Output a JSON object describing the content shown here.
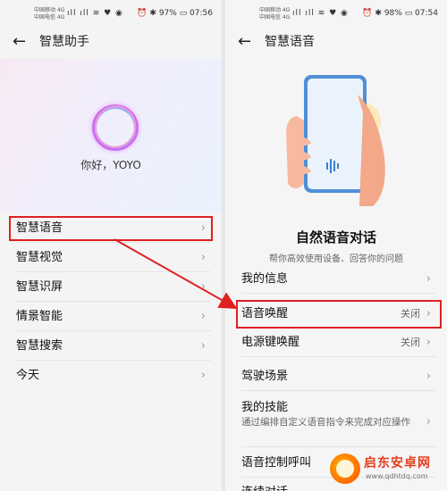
{
  "left": {
    "status": {
      "carrier1": "中国移动 4G",
      "carrier2": "中国电信 4G",
      "signal": "ıll ıll ≋ ♥ ◉",
      "right": "⏰ ✱ 97% ▭ 07:56"
    },
    "title": "智慧助手",
    "greeting": "你好，YOYO",
    "items": [
      {
        "label": "智慧语音"
      },
      {
        "label": "智慧视觉"
      },
      {
        "label": "智慧识屏"
      },
      {
        "label": "情景智能"
      },
      {
        "label": "智慧搜索"
      },
      {
        "label": "今天"
      }
    ]
  },
  "right": {
    "status": {
      "carrier1": "中国移动 4G",
      "carrier2": "中国电信 4G",
      "signal": "ıll ıll ≋ ♥ ◉",
      "right": "⏰ ✱ 98% ▭ 07:54"
    },
    "title": "智慧语音",
    "hero_title": "自然语音对话",
    "hero_subtitle": "帮你高效使用设备、回答你的问题",
    "items": [
      {
        "label": "我的信息",
        "value": ""
      },
      {
        "label": "语音唤醒",
        "value": "关闭"
      },
      {
        "label": "电源键唤醒",
        "value": "关闭"
      },
      {
        "label": "驾驶场景",
        "value": ""
      }
    ],
    "skill": {
      "label": "我的技能",
      "desc": "通过编排自定义语音指令来完成对应操作"
    },
    "bottom_items": [
      {
        "label": "语音控制呼叫"
      },
      {
        "label": "连续对话"
      }
    ]
  },
  "watermark": {
    "title": "启东安卓网",
    "url": "www.qdhtdq.com"
  },
  "colors": {
    "highlight": "#e02020",
    "arrow": "#e02020"
  }
}
